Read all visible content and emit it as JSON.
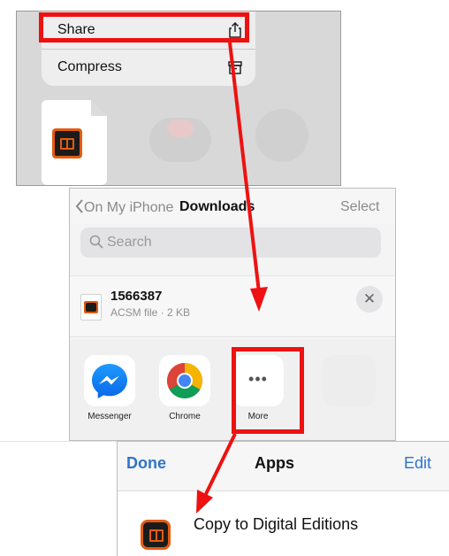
{
  "context_menu": {
    "share_label": "Share",
    "compress_label": "Compress"
  },
  "downloads": {
    "back_label": "On My iPhone",
    "title": "Downloads",
    "select_label": "Select",
    "search_placeholder": "Search",
    "file_name": "1566387",
    "file_meta": "ACSM file · 2 KB",
    "close_symbol": "✕",
    "apps": [
      {
        "name": "Messenger"
      },
      {
        "name": "Chrome"
      },
      {
        "name": "More",
        "symbol": "•••"
      }
    ]
  },
  "apps_sheet": {
    "done_label": "Done",
    "title": "Apps",
    "edit_label": "Edit",
    "row_label": "Copy to Digital Editions"
  },
  "colors": {
    "highlight": "#ee1111",
    "ios_blue": "#2f74c9",
    "acsm_orange": "#e35b12"
  }
}
